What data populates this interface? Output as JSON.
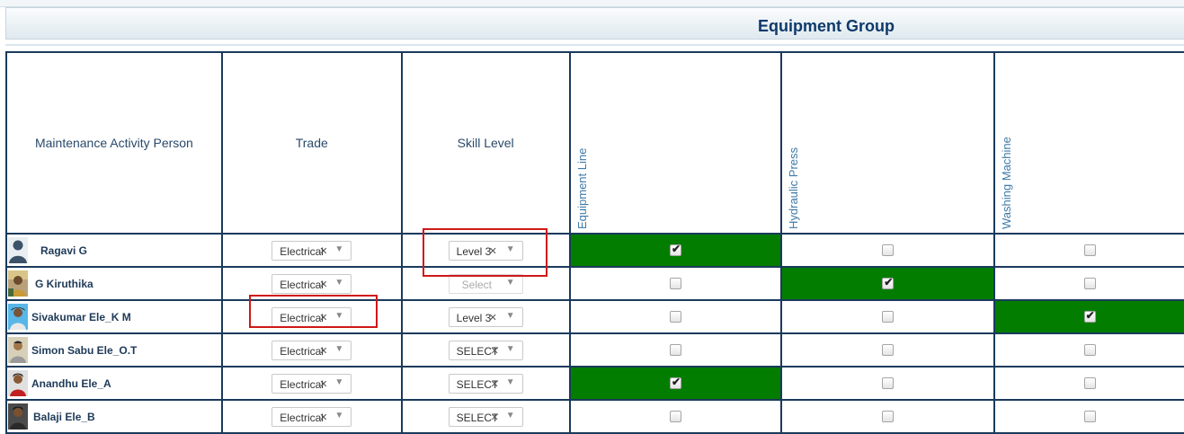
{
  "header": {
    "group_title": "Equipment Group"
  },
  "columns": {
    "person": "Maintenance Activity Person",
    "trade": "Trade",
    "skill": "Skill Level",
    "equipment": [
      "Equipment Line",
      "Hydraulic Press",
      "Washing Machine"
    ]
  },
  "rows": [
    {
      "name": "Ragavi G",
      "trade": "Electrical",
      "skill": "Level 3",
      "skill_is_placeholder": false,
      "checks": [
        true,
        false,
        false
      ]
    },
    {
      "name": "G Kiruthika",
      "trade": "Electrical",
      "skill": "Select",
      "skill_is_placeholder": true,
      "checks": [
        false,
        true,
        false
      ]
    },
    {
      "name": "Sivakumar Ele_K M",
      "trade": "Electrical",
      "skill": "Level 3",
      "skill_is_placeholder": false,
      "checks": [
        false,
        false,
        true
      ]
    },
    {
      "name": "Simon Sabu Ele_O.T",
      "trade": "Electrical",
      "skill": "SELECT",
      "skill_is_placeholder": false,
      "checks": [
        false,
        false,
        false
      ]
    },
    {
      "name": "Anandhu Ele_A",
      "trade": "Electrical",
      "skill": "SELECT",
      "skill_is_placeholder": false,
      "checks": [
        true,
        false,
        false
      ]
    },
    {
      "name": "Balaji Ele_B",
      "trade": "Electrical",
      "skill": "SELECT",
      "skill_is_placeholder": false,
      "checks": [
        false,
        false,
        false
      ]
    }
  ],
  "colors": {
    "checked_cell": "#037d00",
    "header_text": "#0d3a6b",
    "grid_line": "#1a3a5c",
    "highlight": "#d01818"
  },
  "icons": {
    "clear": "clear-x-icon",
    "dropdown": "chevron-down-icon",
    "avatar": "user-avatar"
  }
}
